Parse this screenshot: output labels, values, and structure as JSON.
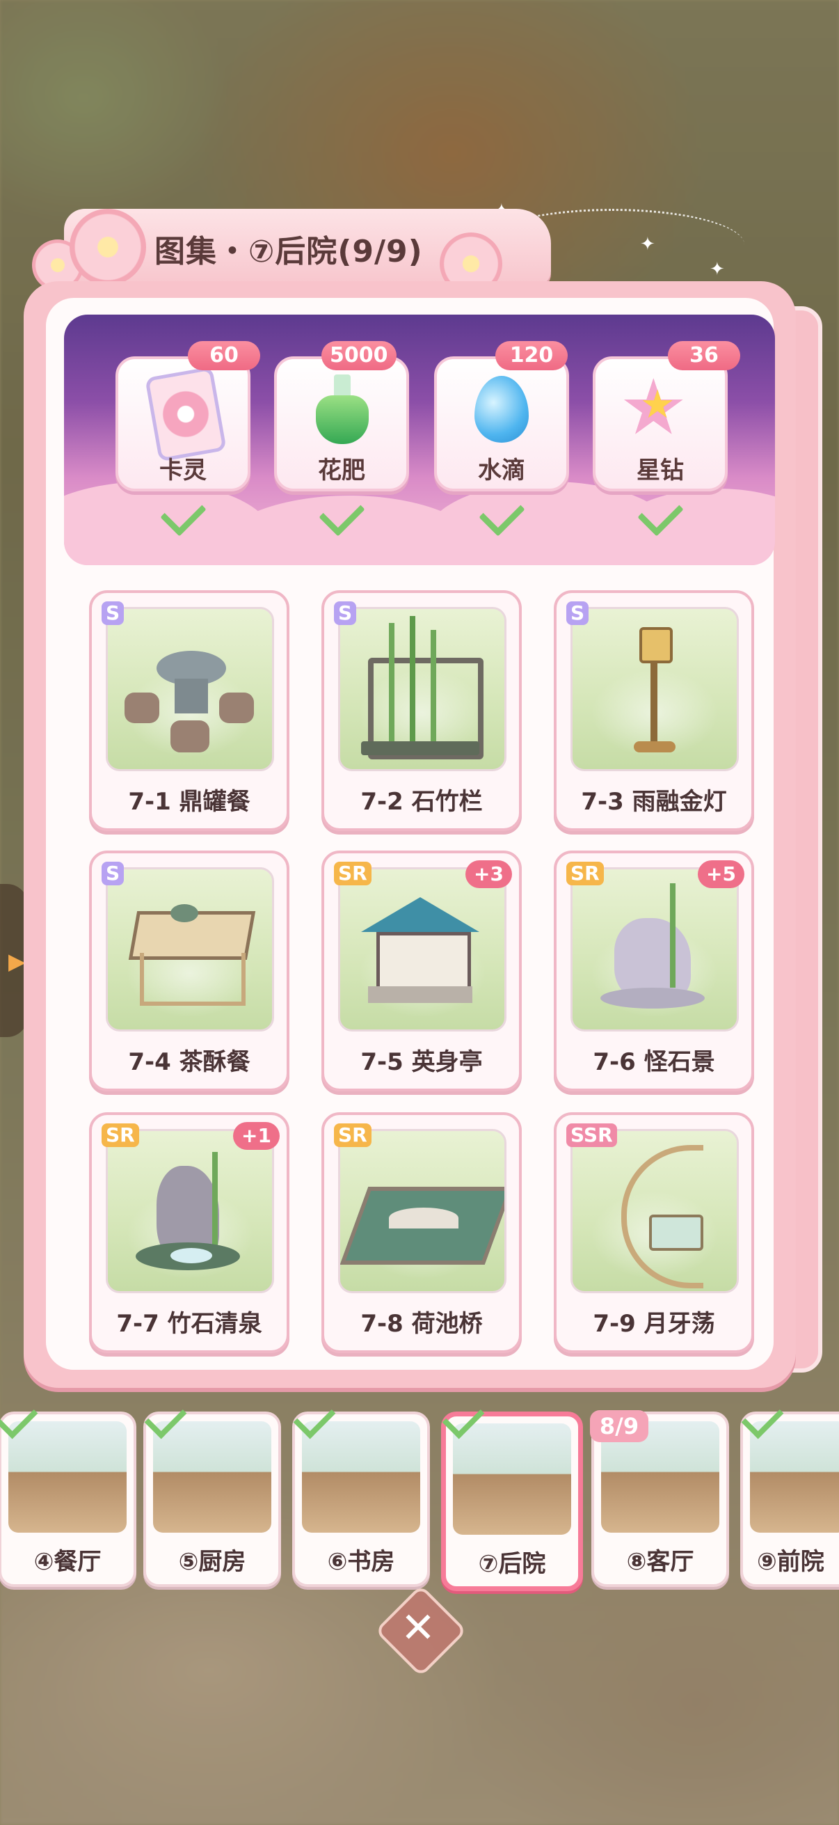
{
  "title": "图集・⑦后院(9/9)",
  "rewards": [
    {
      "label": "卡灵",
      "count": "60",
      "icon": "card-icon",
      "claimed": true
    },
    {
      "label": "花肥",
      "count": "5000",
      "icon": "fertilizer-flask-icon",
      "claimed": true
    },
    {
      "label": "水滴",
      "count": "120",
      "icon": "water-drop-icon",
      "claimed": true
    },
    {
      "label": "星钻",
      "count": "36",
      "icon": "star-diamond-icon",
      "claimed": true
    }
  ],
  "items": [
    {
      "id": "7-1",
      "label": "7-1 鼎罐餐",
      "rarity": "S",
      "plus": ""
    },
    {
      "id": "7-2",
      "label": "7-2 石竹栏",
      "rarity": "S",
      "plus": ""
    },
    {
      "id": "7-3",
      "label": "7-3 雨融金灯",
      "rarity": "S",
      "plus": ""
    },
    {
      "id": "7-4",
      "label": "7-4 茶酥餐",
      "rarity": "S",
      "plus": ""
    },
    {
      "id": "7-5",
      "label": "7-5 英身亭",
      "rarity": "SR",
      "plus": "+3"
    },
    {
      "id": "7-6",
      "label": "7-6 怪石景",
      "rarity": "SR",
      "plus": "+5"
    },
    {
      "id": "7-7",
      "label": "7-7 竹石清泉",
      "rarity": "SR",
      "plus": "+1"
    },
    {
      "id": "7-8",
      "label": "7-8 荷池桥",
      "rarity": "SR",
      "plus": ""
    },
    {
      "id": "7-9",
      "label": "7-9 月牙荡",
      "rarity": "SSR",
      "plus": ""
    }
  ],
  "rooms": [
    {
      "label": "④餐厅",
      "completed": true,
      "progress": ""
    },
    {
      "label": "⑤厨房",
      "completed": true,
      "progress": ""
    },
    {
      "label": "⑥书房",
      "completed": true,
      "progress": ""
    },
    {
      "label": "⑦后院",
      "completed": true,
      "progress": "",
      "selected": true
    },
    {
      "label": "⑧客厅",
      "completed": false,
      "progress": "8/9"
    },
    {
      "label": "⑨前院",
      "completed": true,
      "progress": ""
    }
  ],
  "close_label": "✕",
  "colors": {
    "accent_pink": "#ef6a84",
    "check_green": "#7cc86a",
    "rarity_s": "#b7a2f2",
    "rarity_sr": "#f6b64a",
    "rarity_ssr": "#f08aa7"
  }
}
